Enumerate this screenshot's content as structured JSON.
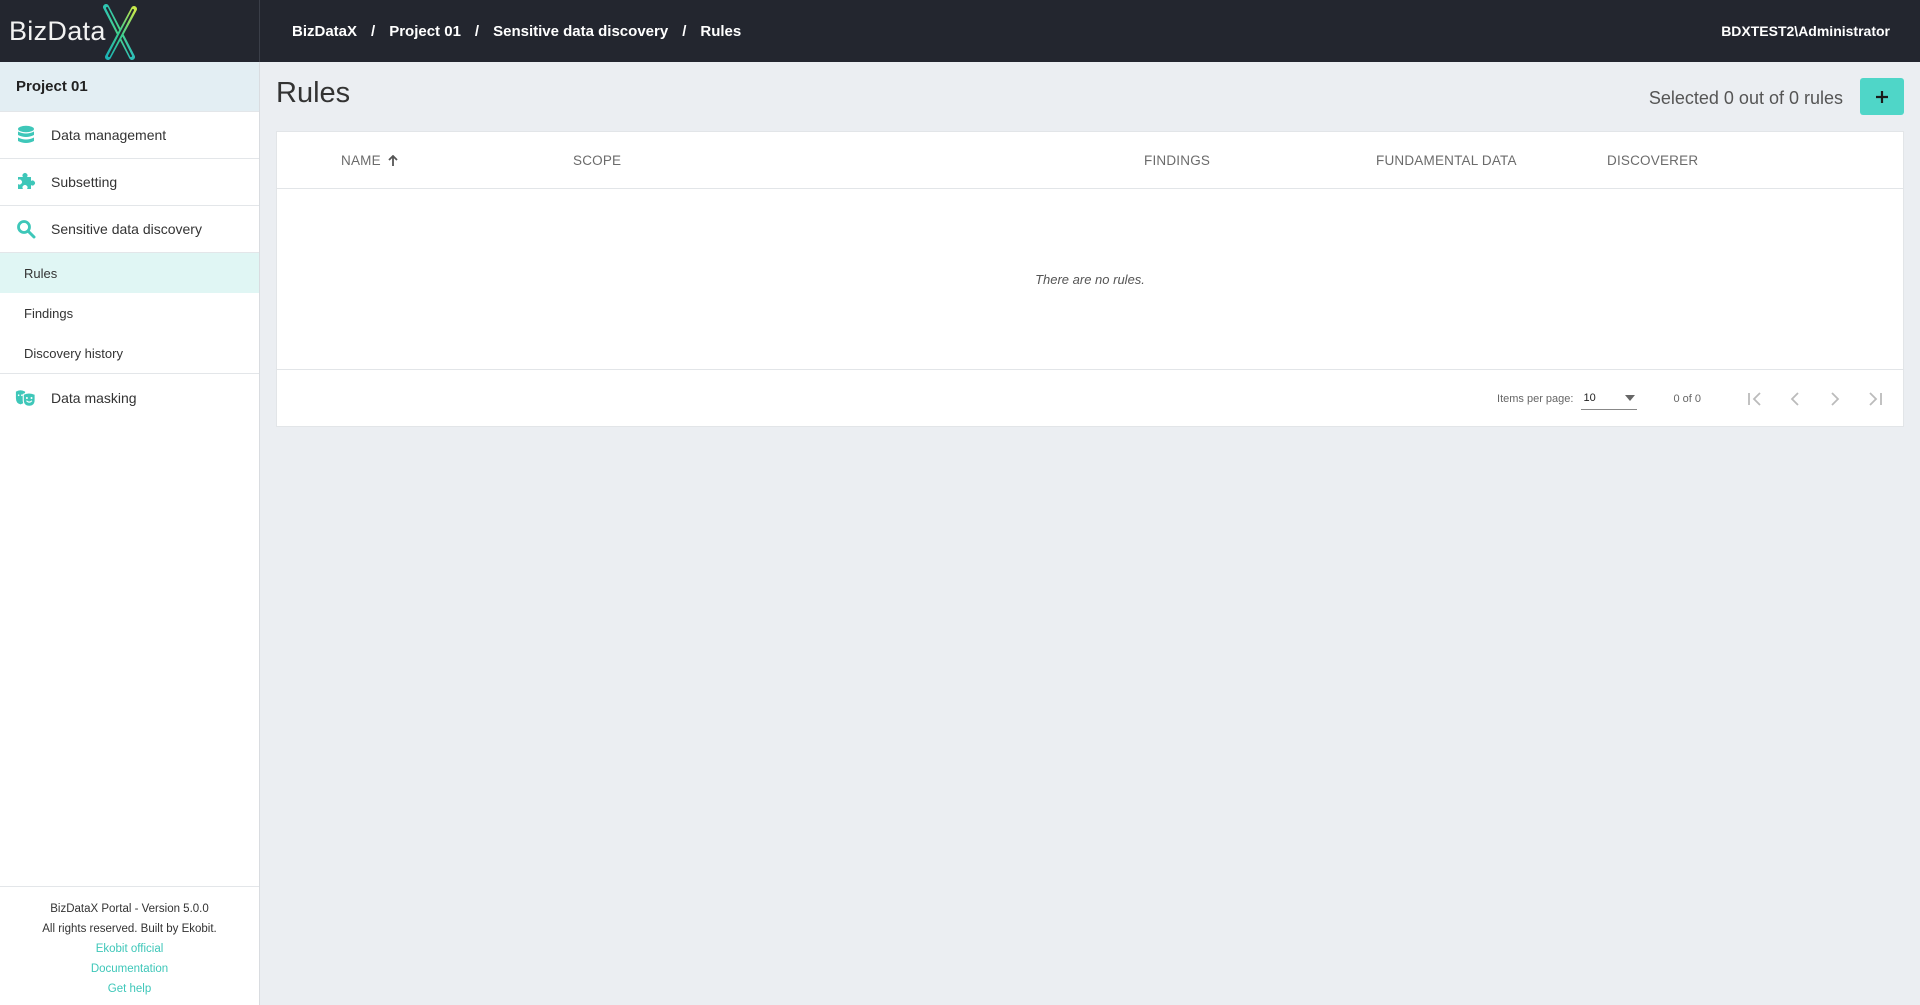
{
  "app": {
    "logo_text": "BizData",
    "logo_x": "X",
    "brand_color": "#4fd6c8"
  },
  "breadcrumb": [
    {
      "label": "BizDataX"
    },
    {
      "label": "Project 01"
    },
    {
      "label": "Sensitive data discovery"
    },
    {
      "label": "Rules"
    }
  ],
  "breadcrumb_separator": "/",
  "user": "BDXTEST2\\Administrator",
  "sidebar": {
    "project": "Project 01",
    "items": [
      {
        "label": "Data management",
        "icon": "database-icon"
      },
      {
        "label": "Subsetting",
        "icon": "puzzle-icon"
      },
      {
        "label": "Sensitive data discovery",
        "icon": "search-icon"
      },
      {
        "label": "Data masking",
        "icon": "masks-icon"
      }
    ],
    "sub_items": [
      {
        "label": "Rules",
        "active": true
      },
      {
        "label": "Findings",
        "active": false
      },
      {
        "label": "Discovery history",
        "active": false
      }
    ],
    "footer": {
      "version": "BizDataX Portal - Version 5.0.0",
      "rights": "All rights reserved. Built by Ekobit.",
      "links": [
        "Ekobit official",
        "Documentation",
        "Get help"
      ]
    }
  },
  "main": {
    "title": "Rules",
    "selected_info": "Selected 0 out of 0 rules",
    "add_button": "+",
    "table": {
      "columns": [
        {
          "label": "NAME",
          "sort": "ascending"
        },
        {
          "label": "SCOPE"
        },
        {
          "label": "FINDINGS"
        },
        {
          "label": "FUNDAMENTAL DATA"
        },
        {
          "label": "DISCOVERER"
        }
      ],
      "rows": [],
      "empty_message": "There are no rules."
    },
    "pagination": {
      "items_per_page_label": "Items per page:",
      "items_per_page": "10",
      "range": "0 of 0"
    }
  }
}
